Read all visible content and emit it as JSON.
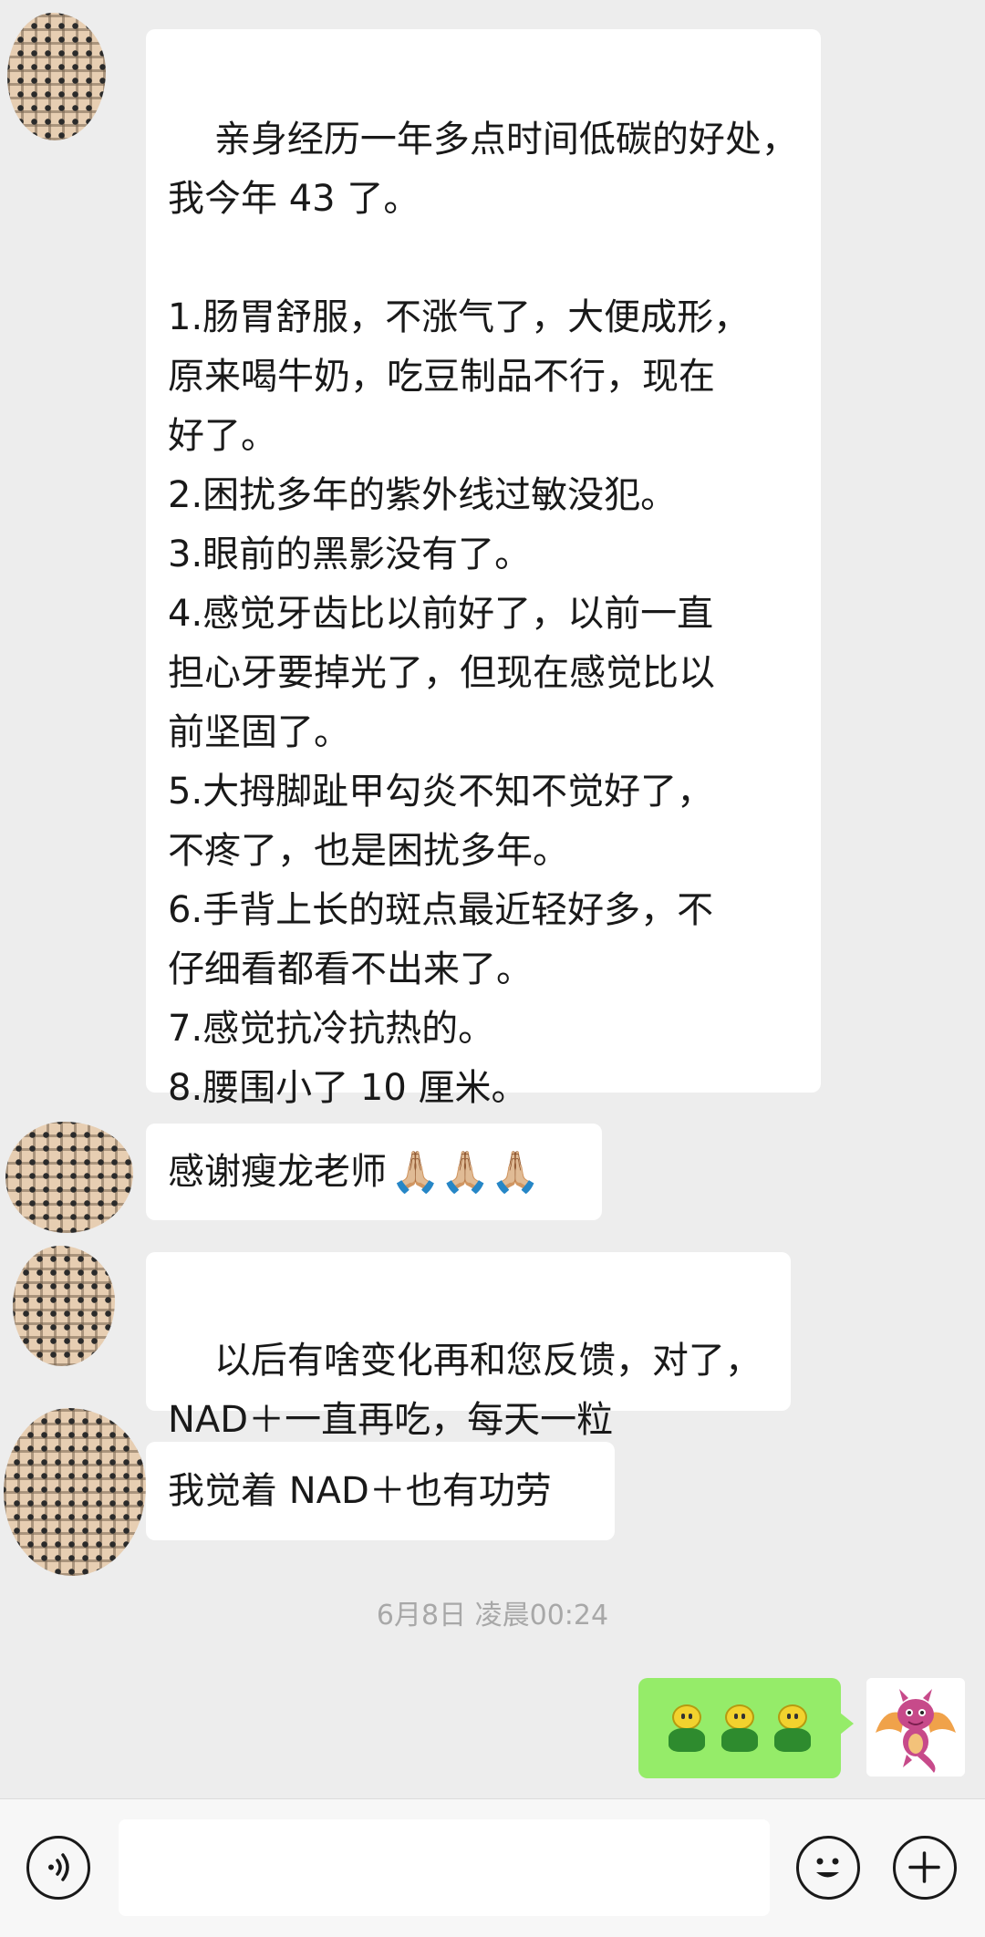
{
  "messages": [
    {
      "sender": "other",
      "text": "亲身经历一年多点时间低碳的好处，\n我今年 43 了。\n\n1.肠胃舒服，不涨气了，大便成形，\n原来喝牛奶，吃豆制品不行，现在\n好了。\n2.困扰多年的紫外线过敏没犯。\n3.眼前的黑影没有了。\n4.感觉牙齿比以前好了，以前一直\n担心牙要掉光了，但现在感觉比以\n前坚固了。\n5.大拇脚趾甲勾炎不知不觉好了，\n不疼了，也是困扰多年。\n6.手背上长的斑点最近轻好多，不\n仔细看都看不出来了。\n7.感觉抗冷抗热的。\n8.腰围小了 10 厘米。"
    },
    {
      "sender": "other",
      "text": "感谢瘦龙老师",
      "emoji": "🙏🏼🙏🏼🙏🏼"
    },
    {
      "sender": "other",
      "text": "以后有啥变化再和您反馈，对了，\nNAD＋一直再吃，每天一粒"
    },
    {
      "sender": "other",
      "text": "我觉着 NAD＋也有功劳"
    }
  ],
  "timestamp": "6月8日 凌晨00:24",
  "my_message": {
    "sticker": "three-green-smiley-figures"
  },
  "composer": {
    "voice_icon": "voice-icon",
    "emoji_icon": "emoji-icon",
    "plus_icon": "plus-icon",
    "input_value": ""
  },
  "colors": {
    "chat_background": "#ededed",
    "incoming_bubble": "#ffffff",
    "outgoing_bubble": "#95ec69",
    "timestamp_text": "#a8a8a8"
  }
}
